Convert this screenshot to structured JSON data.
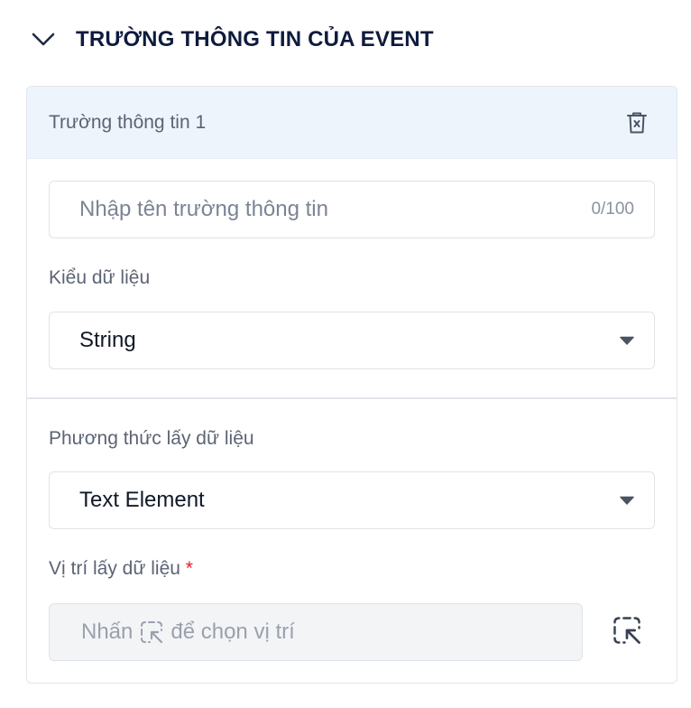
{
  "section": {
    "title": "TRƯỜNG THÔNG TIN CỦA EVENT"
  },
  "card": {
    "title": "Trường thông tin 1",
    "name_field": {
      "placeholder": "Nhập tên trường thông tin",
      "value": "",
      "counter": "0/100"
    },
    "data_type": {
      "label": "Kiểu dữ liệu",
      "selected": "String"
    },
    "method": {
      "label": "Phương thức lấy dữ liệu",
      "selected": "Text Element"
    },
    "position": {
      "label": "Vị trí lấy dữ liệu",
      "required_mark": "*",
      "hint_before": "Nhấn",
      "hint_after": "để chọn vị trí"
    }
  },
  "icons": {
    "collapse": "chevron-down-icon",
    "delete": "trash-icon",
    "dropdown": "caret-down-icon",
    "picker": "element-picker-icon"
  },
  "colors": {
    "title": "#0f1b3d",
    "card_header_bg": "#eef4fc",
    "required": "#e11d2e",
    "disabled_bg": "#f3f4f6"
  }
}
